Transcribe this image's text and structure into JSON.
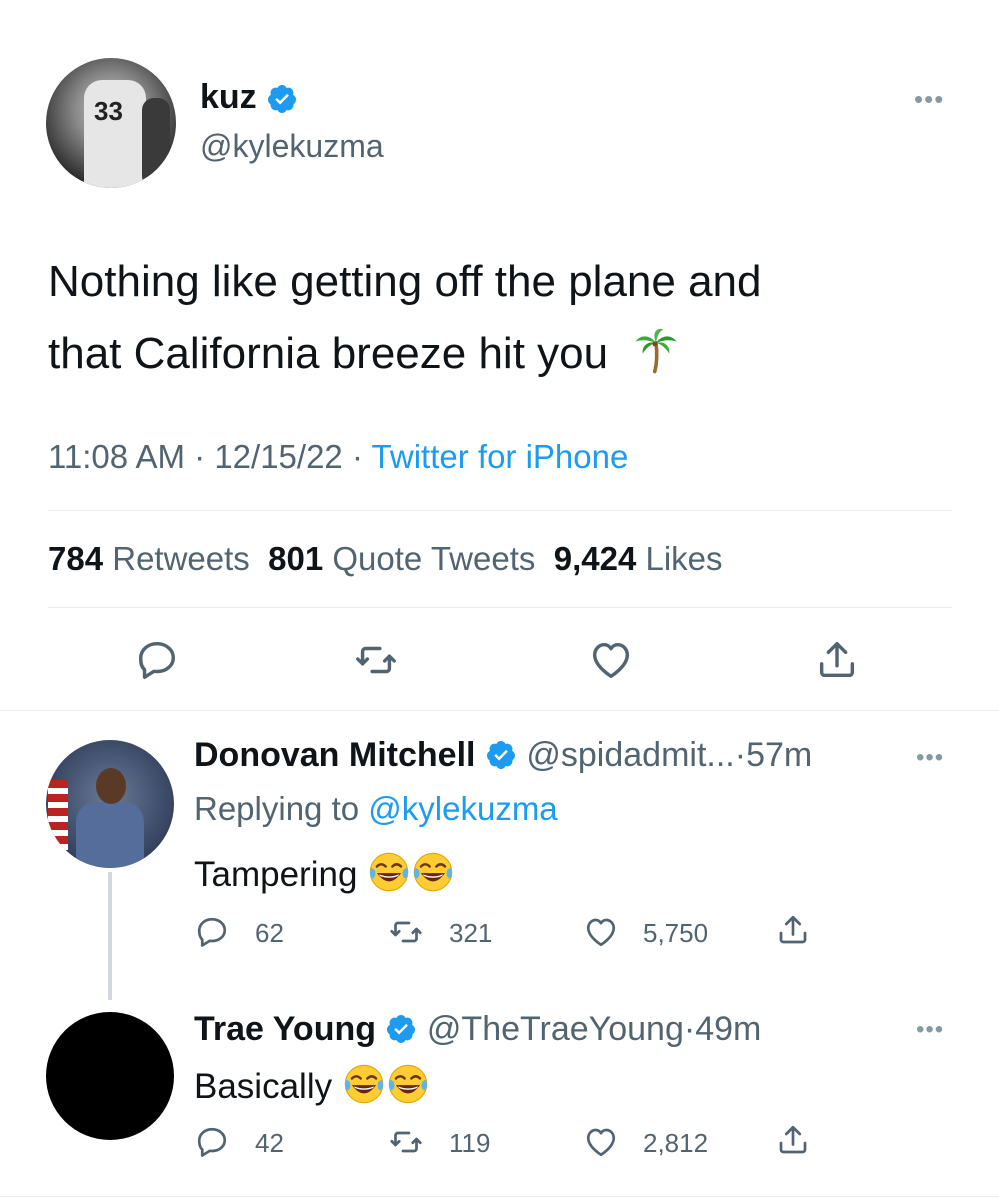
{
  "main_tweet": {
    "name": "kuz",
    "handle": "@kylekuzma",
    "avatar_jersey_number": "33",
    "text_line1": "Nothing like getting off the plane and",
    "text_line2": "that California breeze hit you",
    "time": "11:08 AM",
    "date": "12/15/22",
    "source": "Twitter for iPhone",
    "separator": "·",
    "retweets_count": "784",
    "retweets_label": "Retweets",
    "quotes_count": "801",
    "quotes_label": "Quote Tweets",
    "likes_count": "9,424",
    "likes_label": "Likes",
    "more": "•••"
  },
  "replies": [
    {
      "name": "Donovan Mitchell",
      "handle": "@spidadmit...",
      "time": "57m",
      "separator": "·",
      "replying_prefix": "Replying to",
      "replying_to": "@kylekuzma",
      "text": "Tampering",
      "reply_count": "62",
      "retweet_count": "321",
      "like_count": "5,750",
      "more": "•••"
    },
    {
      "name": "Trae Young",
      "handle": "@TheTraeYoung",
      "time": "49m",
      "separator": "·",
      "text": "Basically",
      "reply_count": "42",
      "retweet_count": "119",
      "like_count": "2,812",
      "more": "•••"
    }
  ],
  "icons": {
    "verified": "verified-badge-icon",
    "palm": "palm-tree-emoji",
    "laugh": "tears-of-joy-emoji",
    "reply": "reply-icon",
    "retweet": "retweet-icon",
    "like": "heart-icon",
    "share": "share-icon"
  },
  "colors": {
    "link": "#1d9bf0",
    "muted": "#536471",
    "text": "#0f1419",
    "divider": "#e6ecf0"
  }
}
